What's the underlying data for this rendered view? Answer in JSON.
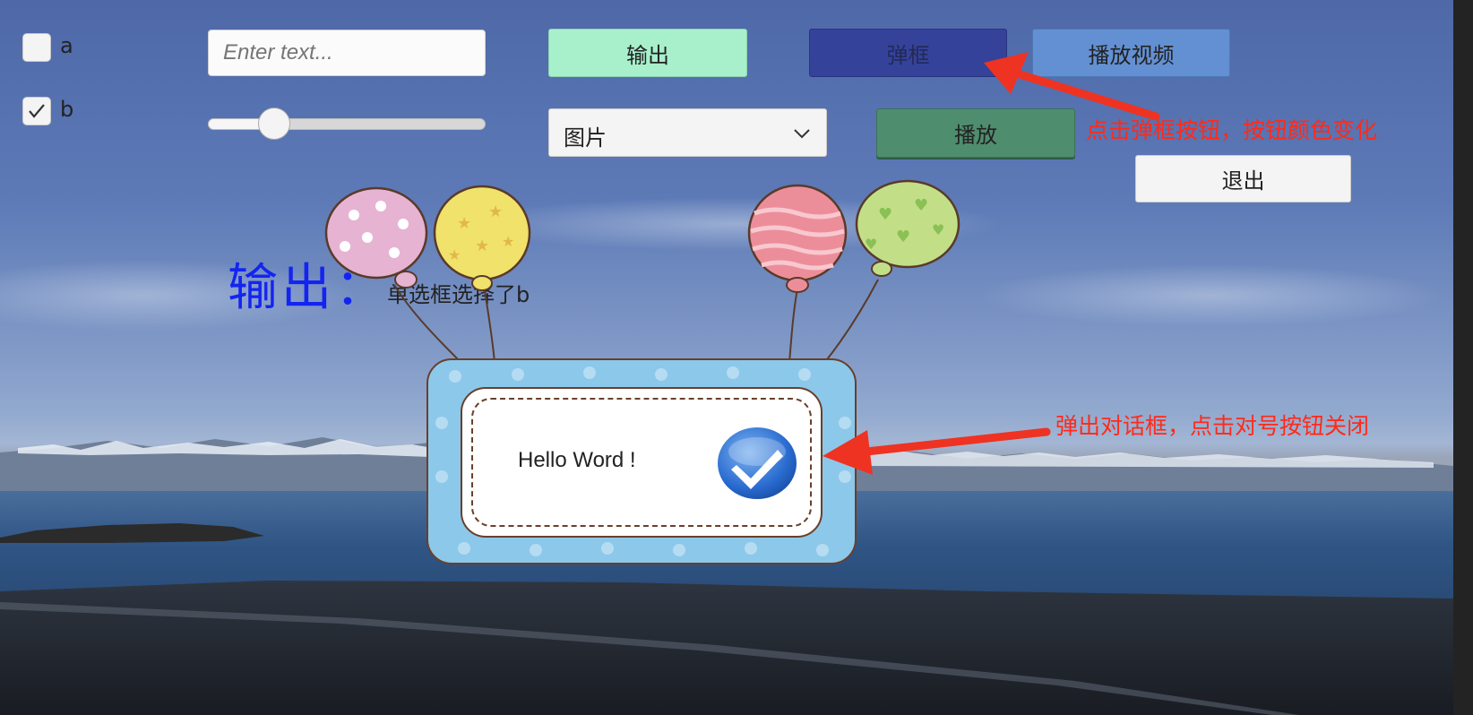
{
  "toggles": [
    {
      "label": "a",
      "checked": false
    },
    {
      "label": "b",
      "checked": true
    }
  ],
  "input": {
    "placeholder": "Enter text...",
    "value": ""
  },
  "slider": {
    "value": 0.3
  },
  "buttons": {
    "output": "输出",
    "popup": "弹框",
    "play_video": "播放视频",
    "play": "播放",
    "exit": "退出"
  },
  "dropdown": {
    "selected": "图片"
  },
  "output_area": {
    "title": "输出：",
    "message": "单选框选择了b"
  },
  "dialog": {
    "message": "Hello Word !",
    "confirm_icon": "check-icon"
  },
  "annotations": {
    "popup_note": "点击弹框按钮，按钮颜色变化",
    "dialog_note": "弹出对话框，点击对号按钮关闭"
  },
  "colors": {
    "output_button": "#a8f0cc",
    "popup_button": "#35429a",
    "play_video_button": "#6390d2",
    "play_button": "#4e8d6e",
    "exit_button": "#f4f4f4",
    "output_title": "#1424f0",
    "annotation": "#ff2a1a",
    "dialog_frame": "#8cc8ea"
  }
}
